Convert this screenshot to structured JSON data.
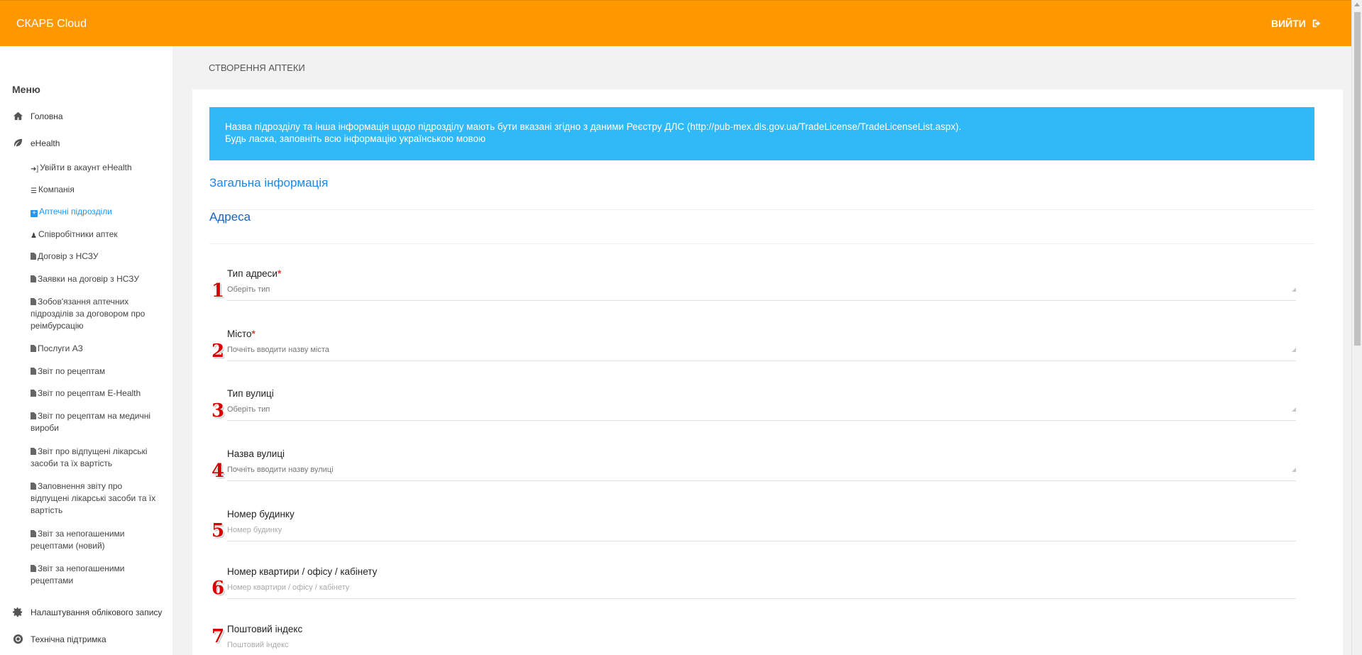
{
  "header": {
    "brand": "СКАРБ Cloud",
    "logout_label": "ВИЙТИ",
    "logout_icon": "sign-out-icon",
    "color": "#ff9800"
  },
  "sidebar": {
    "menu_title": "Меню",
    "home": "Головна",
    "ehealth": "eHealth",
    "sub_items": [
      "Увійти в акаунт eHealth",
      "Компанія",
      "Аптечні підрозділи",
      "Співробітники аптек",
      "Договір з НСЗУ",
      "Заявки на договір з НСЗУ",
      "Зобов'язання аптечних підрозділів за договором про реімбурсацію",
      "Послуги АЗ",
      "Звіт по рецептам",
      "Звіт по рецептам E-Health",
      "Звіт по рецептам на медичні вироби",
      "Звіт про відпущені лікарські засоби та їх вартість",
      "Заповнення звіту про відпущені лікарські засоби та їх вартість",
      "Звіт за непогашеними рецептами (новий)",
      "Звіт за непогашеними рецептами"
    ],
    "account_settings": "Налаштування облікового запису",
    "support": "Технічна підтримка"
  },
  "page": {
    "title": "СТВОРЕННЯ АПТЕКИ",
    "banner_line1": "Назва підрозділу та інша інформація щодо підрозділу мають бути вказані згідно з даними Реєстру ДЛС (http://pub-mex.dls.gov.ua/TradeLicense/TradeLicenseList.aspx).",
    "banner_line2": "Будь ласка, заповніть всю інформацію українською мовою",
    "section_general": "Загальна інформація",
    "section_address": "Адреса"
  },
  "fields": [
    {
      "num": "1",
      "label": "Тип адреси",
      "required": "*",
      "value": "Оберіть тип"
    },
    {
      "num": "2",
      "label": "Місто",
      "required": "*",
      "value": "Почніть вводити назву міста"
    },
    {
      "num": "3",
      "label": "Тип вулиці",
      "value": "Оберіть тип"
    },
    {
      "num": "4",
      "label": "Назва вулиці",
      "value": "Почніть вводити назву вулиці"
    },
    {
      "num": "5",
      "label": "Номер будинку",
      "value": "Номер будинку"
    },
    {
      "num": "6",
      "label": "Номер квартири / офісу / кабінету",
      "value": "Номер квартири / офісу / кабінету"
    },
    {
      "num": "7",
      "label": "Поштовий індекс",
      "value": "Поштовий індекс"
    }
  ]
}
